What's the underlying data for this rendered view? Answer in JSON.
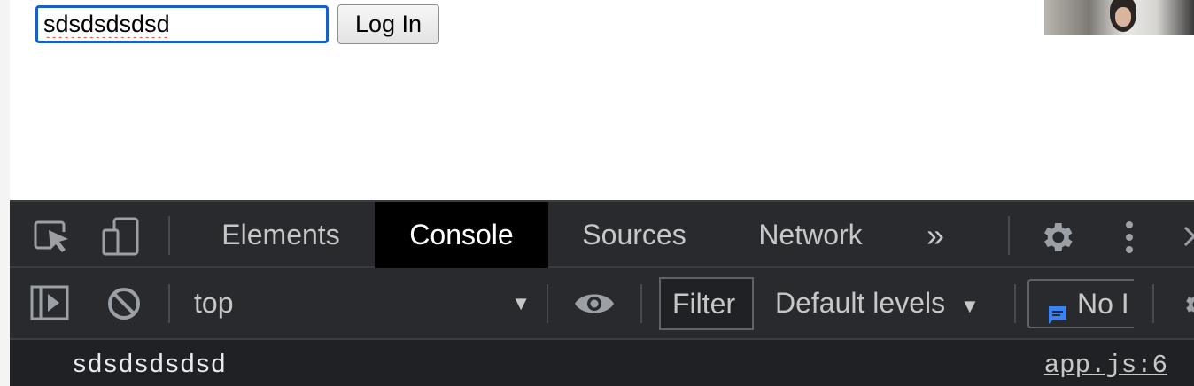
{
  "page": {
    "input_value": "sdsdsdsdsd",
    "login_button_label": "Log In"
  },
  "devtools": {
    "tabs": [
      {
        "label": "Elements"
      },
      {
        "label": "Console"
      },
      {
        "label": "Sources"
      },
      {
        "label": "Network"
      }
    ],
    "active_tab": "Console",
    "more_tabs_label": "»",
    "toolbar": {
      "context": "top",
      "filter_placeholder": "Filter",
      "levels_label": "Default levels",
      "issues_label": "No I"
    },
    "console": {
      "messages": [
        {
          "text": "sdsdsdsdsd",
          "source": "app.js:6"
        }
      ]
    }
  },
  "colors": {
    "devtools_bg": "#202124",
    "active_tab_bg": "#000000",
    "input_focus_border": "#1a5fc9",
    "issues_icon": "#3b82f6"
  }
}
